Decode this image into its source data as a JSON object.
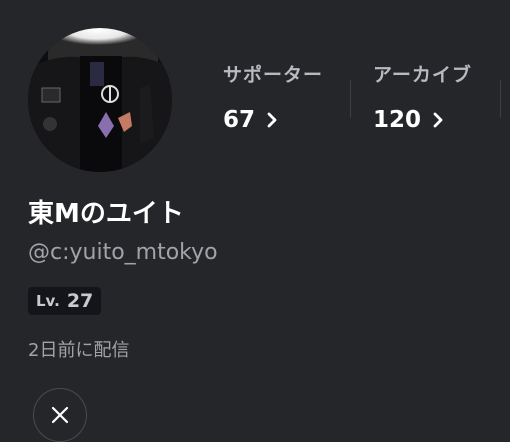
{
  "profile": {
    "display_name": "東Mのユイト",
    "handle": "@c:yuito_mtokyo",
    "level_prefix": "Lv.",
    "level_value": "27",
    "last_stream": "2日前に配信"
  },
  "stats": [
    {
      "label": "サポーター",
      "value": "67"
    },
    {
      "label": "アーカイブ",
      "value": "120"
    }
  ],
  "social": {
    "x_icon": "x-logo-icon"
  },
  "colors": {
    "background": "#25262a",
    "text": "#ffffff",
    "muted": "#a2a3a8",
    "badge": "#14151a"
  }
}
